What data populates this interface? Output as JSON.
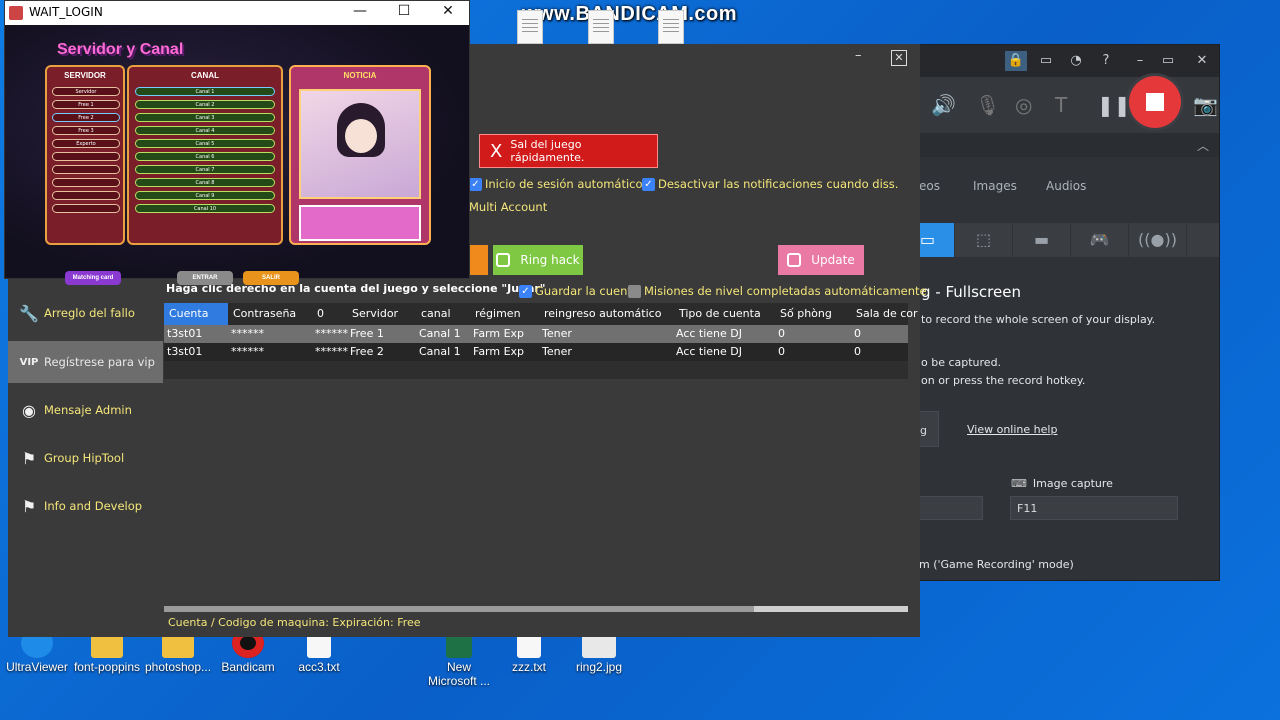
{
  "desktop": {
    "watermark": "www.BANDICAM.com",
    "icons": [
      {
        "label": "UltraViewer"
      },
      {
        "label": "font-poppins"
      },
      {
        "label": "photoshop..."
      },
      {
        "label": "Bandicam"
      },
      {
        "label": "acc3.txt"
      },
      {
        "label": "New\nMicrosoft ..."
      },
      {
        "label": "zzz.txt"
      },
      {
        "label": "ring2.jpg"
      }
    ]
  },
  "game_window": {
    "title": "WAIT_LOGIN",
    "banner_title": "Servidor y Canal",
    "server_heading": "SERVIDOR",
    "channel_heading": "CANAL",
    "news_heading": "NOTICIA",
    "servers": [
      "Servidor",
      "Free 1",
      "Free 2",
      "Free 3",
      "Experto",
      "",
      "",
      "",
      "",
      ""
    ],
    "channels": [
      "Canal 1",
      "Canal 2",
      "Canal 3",
      "Canal 4",
      "Canal 5",
      "Canal 6",
      "Canal 7",
      "Canal 8",
      "Canal 9",
      "Canal 10"
    ],
    "buttons": {
      "matching": "Matching card",
      "enter": "ENTRAR",
      "exit": "SALIR"
    }
  },
  "tool": {
    "alert": "Sal del juego rápidamente.",
    "checks": {
      "auto_login": "Inicio de sesión automático",
      "disable_notifications": "Desactivar las notificaciones cuando diss.",
      "multi_account": "Multi Account",
      "save_account": "Guardar la cuenta",
      "auto_missions": "Misiones  de  nivel  completadas  automáticamente"
    },
    "buttons": {
      "ring_hack": "Ring hack",
      "update": "Update"
    },
    "sidebar": [
      {
        "label": "Arreglo del fallo",
        "icon": "wrench-icon"
      },
      {
        "label": "Regístrese para vip",
        "icon": "vip-icon"
      },
      {
        "label": "Mensaje Admin",
        "icon": "messenger-icon"
      },
      {
        "label": "Group HipTool",
        "icon": "flag-icon"
      },
      {
        "label": "Info and Develop",
        "icon": "flag-icon"
      }
    ],
    "hint": "Haga clic derecho en la cuenta del juego y seleccione \"Jugar\"",
    "table": {
      "headers": [
        "Cuenta",
        "Contraseña",
        "0",
        "Servidor",
        "canal",
        "régimen",
        "reingreso automático",
        "Tipo de cuenta",
        "Số phòng",
        "Sala de cor"
      ],
      "rows": [
        [
          "t3st01",
          "******",
          "******",
          "Free 1",
          "Canal 1",
          "Farm Exp",
          "Tener",
          "Acc tiene DJ",
          "0",
          "0"
        ],
        [
          "t3st01",
          "******",
          "******",
          "Free 2",
          "Canal 1",
          "Farm Exp",
          "Tener",
          "Acc tiene DJ",
          "0",
          "0"
        ]
      ]
    },
    "footer": "Cuenta / Codigo de maquina:  Expiración: Free"
  },
  "bandicam": {
    "tabs": [
      "eos",
      "Images",
      "Audios"
    ],
    "mode_title": "g - Fullscreen",
    "desc1": "to record the whole screen of your display.",
    "desc2": "o be captured.",
    "desc3": "on or press the record hotkey.",
    "help_button": "g",
    "help_link": "View online help",
    "image_capture_label": "Image capture",
    "image_capture_key": "F11",
    "footer": "m ('Game Recording' mode)"
  }
}
